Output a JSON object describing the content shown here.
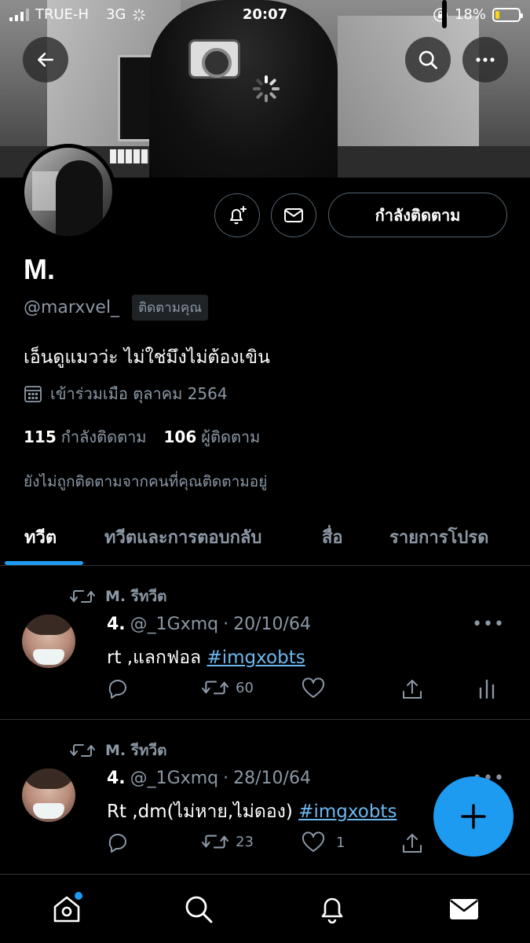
{
  "status_bar": {
    "carrier": "TRUE-H",
    "network": "3G",
    "time": "20:07",
    "battery_percent": "18%",
    "battery_level": 0.18
  },
  "profile": {
    "name": "M.",
    "handle": "@marxvel_",
    "follows_you_badge": "ติดตามคุณ",
    "bio": "เอ็นดูแมวว่ะ ไม่ใช่มึงไม่ต้องเขิน",
    "joined": "เข้าร่วมเมือ ตุลาคม 2564",
    "following_count": "115",
    "following_label": "กำลังติดตาม",
    "followers_count": "106",
    "followers_label": "ผู้ติดตาม",
    "not_followed_note": "ยังไม่ถูกติดตามจากคนที่คุณติดตามอยู่",
    "follow_button": "กำลังติดตาม"
  },
  "tabs": [
    {
      "label": "ทวีต",
      "active": true
    },
    {
      "label": "ทวีตและการตอบกลับ",
      "active": false
    },
    {
      "label": "สื่อ",
      "active": false
    },
    {
      "label": "รายการโปรด",
      "active": false
    }
  ],
  "tweets": [
    {
      "retweeted_by": "M. รีทวีต",
      "author": "4.",
      "handle": "@_1Gxmq",
      "dot": "·",
      "date": "20/10/64",
      "text": "rt ,แลกฟอล ",
      "hashtag": "#imgxobts",
      "retweets": "60",
      "likes": ""
    },
    {
      "retweeted_by": "M. รีทวีต",
      "author": "4.",
      "handle": "@_1Gxmq",
      "dot": "·",
      "date": "28/10/64",
      "text": "Rt ,dm(ไม่หาย,ไม่ดอง) ",
      "hashtag": "#imgxobts",
      "retweets": "23",
      "likes": "1"
    }
  ],
  "more_glyph": "•••",
  "colors": {
    "accent": "#1d9bf0",
    "background": "#000000",
    "secondary_text": "#8b98a5",
    "hashtag": "#6cb8ee"
  },
  "icons": [
    "back-arrow-icon",
    "search-icon",
    "more-icon",
    "bell-plus-icon",
    "mail-icon",
    "calendar-icon",
    "reply-icon",
    "retweet-icon",
    "like-icon",
    "share-icon",
    "analytics-icon",
    "compose-plus-icon",
    "home-icon",
    "bell-icon"
  ]
}
